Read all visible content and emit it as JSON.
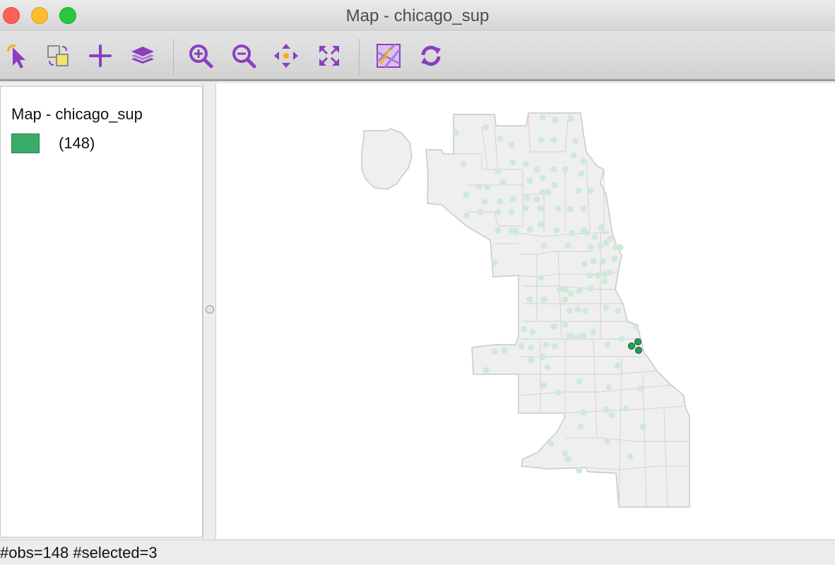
{
  "window": {
    "title": "Map - chicago_sup"
  },
  "toolbar": {
    "buttons": [
      {
        "name": "select-tool",
        "icon": "select-arrow-icon"
      },
      {
        "name": "copy-image",
        "icon": "copy-image-icon"
      },
      {
        "name": "add-layer",
        "icon": "plus-icon"
      },
      {
        "name": "layers",
        "icon": "layers-icon"
      },
      {
        "name": "zoom-in",
        "icon": "zoom-in-icon"
      },
      {
        "name": "zoom-out",
        "icon": "zoom-out-icon"
      },
      {
        "name": "pan",
        "icon": "pan-icon"
      },
      {
        "name": "full-extent",
        "icon": "full-extent-icon"
      },
      {
        "name": "basemap",
        "icon": "basemap-icon"
      },
      {
        "name": "refresh",
        "icon": "refresh-icon"
      }
    ],
    "icon_color": "#8a3fbf"
  },
  "legend": {
    "title": "Map - chicago_sup",
    "items": [
      {
        "label": "(148)",
        "color": "#3aac6a"
      }
    ]
  },
  "map": {
    "fill_color": "#efefef",
    "boundary_color": "#c8c8c8",
    "point_color_unselected": "#cfe9d7",
    "point_color_selected": "#2e9b57"
  },
  "status": {
    "text": "#obs=148 #selected=3"
  }
}
